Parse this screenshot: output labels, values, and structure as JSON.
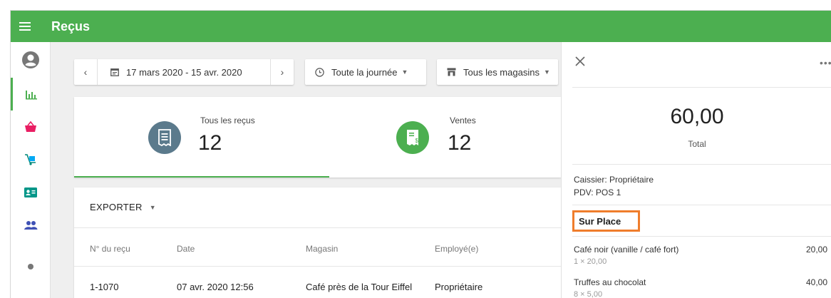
{
  "app": {
    "title": "Reçus"
  },
  "filters": {
    "date_range": "17 mars 2020 - 15 avr. 2020",
    "prev_arrow": "‹",
    "next_arrow": "›",
    "time": "Toute la journée",
    "stores": "Tous les magasins",
    "caret": "▼"
  },
  "stats": [
    {
      "label": "Tous les reçus",
      "value": "12",
      "color": "#5b7a8c",
      "icon": "receipt-icon"
    },
    {
      "label": "Ventes",
      "value": "12",
      "color": "#4caf50",
      "icon": "sale-receipt-icon"
    }
  ],
  "table": {
    "export_label": "EXPORTER",
    "headers": [
      "N° du reçu",
      "Date",
      "Magasin",
      "Employé(e)"
    ],
    "rows": [
      [
        "1-1070",
        "07 avr. 2020 12:56",
        "Café près de la Tour Eiffel",
        "Propriétaire"
      ]
    ]
  },
  "sidebar": {
    "items": [
      "account-icon",
      "reports-icon",
      "items-icon",
      "inventory-icon",
      "employees-icon",
      "customers-icon"
    ],
    "colors": {
      "active": "#4caf50",
      "items": "#e91e63",
      "inventory": "#03a9f4",
      "employees": "#009688",
      "customers": "#3f51b5"
    }
  },
  "receipt_panel": {
    "total_value": "60,00",
    "total_label": "Total",
    "cashier": "Caissier: Propriétaire",
    "pos": "PDV: POS 1",
    "dining_option": "Sur Place",
    "more": "•••",
    "items": [
      {
        "name": "Café noir (vanille / café fort)",
        "qty": "1 × 20,00",
        "amount": "20,00"
      },
      {
        "name": "Truffes au chocolat",
        "qty": "8 × 5,00",
        "amount": "40,00"
      }
    ]
  },
  "colors": {
    "brand": "#4caf50",
    "highlight": "#ef7d2c"
  }
}
